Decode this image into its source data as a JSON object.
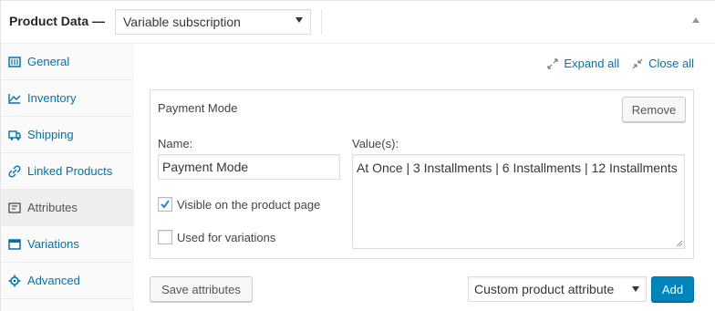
{
  "header": {
    "title": "Product Data —",
    "product_type": "Variable subscription"
  },
  "tabs": [
    {
      "label": "General",
      "icon": "grid-icon",
      "active": false
    },
    {
      "label": "Inventory",
      "icon": "chart-icon",
      "active": false
    },
    {
      "label": "Shipping",
      "icon": "truck-icon",
      "active": false
    },
    {
      "label": "Linked Products",
      "icon": "link-icon",
      "active": false
    },
    {
      "label": "Attributes",
      "icon": "list-icon",
      "active": true
    },
    {
      "label": "Variations",
      "icon": "window-icon",
      "active": false
    },
    {
      "label": "Advanced",
      "icon": "gear-icon",
      "active": false
    }
  ],
  "toolbar": {
    "expand_all": "Expand all",
    "close_all": "Close all"
  },
  "attribute": {
    "title": "Payment Mode",
    "remove_label": "Remove",
    "name_label": "Name:",
    "name_value": "Payment Mode",
    "values_label": "Value(s):",
    "values_value": "At Once | 3 Installments | 6 Installments | 12 Installments",
    "visible_label": "Visible on the product page",
    "visible_checked": true,
    "variations_label": "Used for variations",
    "variations_checked": false
  },
  "footer": {
    "save_label": "Save attributes",
    "attribute_select": "Custom product attribute",
    "add_label": "Add"
  },
  "colors": {
    "link": "#0073aa",
    "primary_button": "#0085ba"
  }
}
